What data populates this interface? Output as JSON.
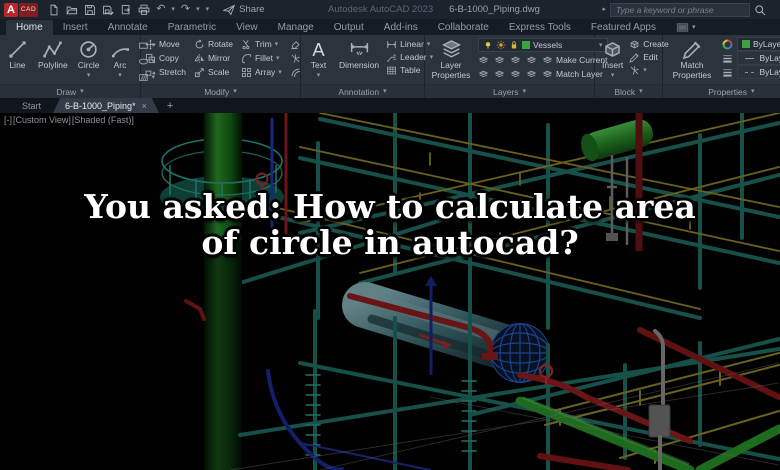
{
  "titlebar": {
    "app_title": "Autodesk AutoCAD 2023",
    "doc_title": "6-B-1000_Piping.dwg",
    "share_label": "Share",
    "search_placeholder": "Type a keyword or phrase",
    "logo_a": "A",
    "logo_cad": "CAD"
  },
  "glyphs": {
    "caret": "▾",
    "expand": "▸",
    "undo": "↶",
    "redo": "↷",
    "close": "×",
    "plus": "+"
  },
  "ribbon": {
    "tabs": [
      "Home",
      "Insert",
      "Annotate",
      "Parametric",
      "View",
      "Manage",
      "Output",
      "Add-ins",
      "Collaborate",
      "Express Tools",
      "Featured Apps"
    ],
    "panels": {
      "draw": {
        "label": "Draw",
        "items": [
          "Line",
          "Polyline",
          "Circle",
          "Arc"
        ]
      },
      "modify": {
        "label": "Modify",
        "items": [
          "Move",
          "Copy",
          "Stretch",
          "Rotate",
          "Mirror",
          "Scale",
          "Trim",
          "Fillet",
          "Array"
        ]
      },
      "annotation": {
        "label": "Annotation",
        "items": [
          "Text",
          "Dimension",
          "Linear",
          "Leader",
          "Table"
        ]
      },
      "layers": {
        "label": "Layers",
        "layer_properties": "Layer Properties",
        "current_layer": "Vessels",
        "make_current": "Make Current",
        "match_layer": "Match Layer"
      },
      "block": {
        "label": "Block",
        "items": [
          "Insert",
          "Create",
          "Edit"
        ]
      },
      "properties": {
        "label": "Properties",
        "match_properties": "Match Properties",
        "color": "ByLayer",
        "lineweight": "ByLayer",
        "linetype": "ByLayer"
      }
    }
  },
  "file_tabs": {
    "start_label": "Start",
    "doc_label": "6-B-1000_Piping*"
  },
  "viewport": {
    "controls": [
      "[-]",
      "[Custom View]",
      "[Shaded (Fast)]"
    ]
  },
  "overlay": {
    "line1": "You asked: How to calculate area",
    "line2": "of circle in autocad?"
  },
  "colors": {
    "logo_red": "#b9262c",
    "layer_swatch_green": "#3da23d",
    "viewport_bg": "#020203",
    "headline_text": "#ffffff"
  }
}
